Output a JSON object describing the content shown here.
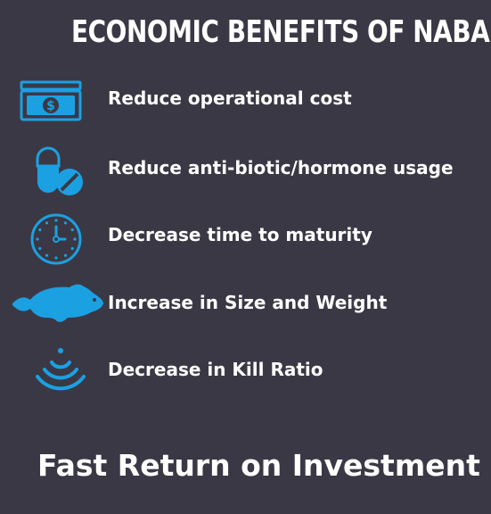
{
  "title": "ECONOMIC BENEFITS OF NABAS",
  "colors": {
    "background": "#3b3845",
    "icon": "#1ba1e2",
    "text": "#ffffff"
  },
  "benefits": [
    {
      "icon": "money-icon",
      "label": "Reduce operational cost"
    },
    {
      "icon": "pill-icon",
      "label": "Reduce anti-biotic/hormone usage"
    },
    {
      "icon": "clock-icon",
      "label": "Decrease time to maturity"
    },
    {
      "icon": "fish-icon",
      "label": "Increase in Size and Weight"
    },
    {
      "icon": "signal-icon",
      "label": "Decrease in Kill Ratio"
    }
  ],
  "footer": "Fast Return on Investment"
}
